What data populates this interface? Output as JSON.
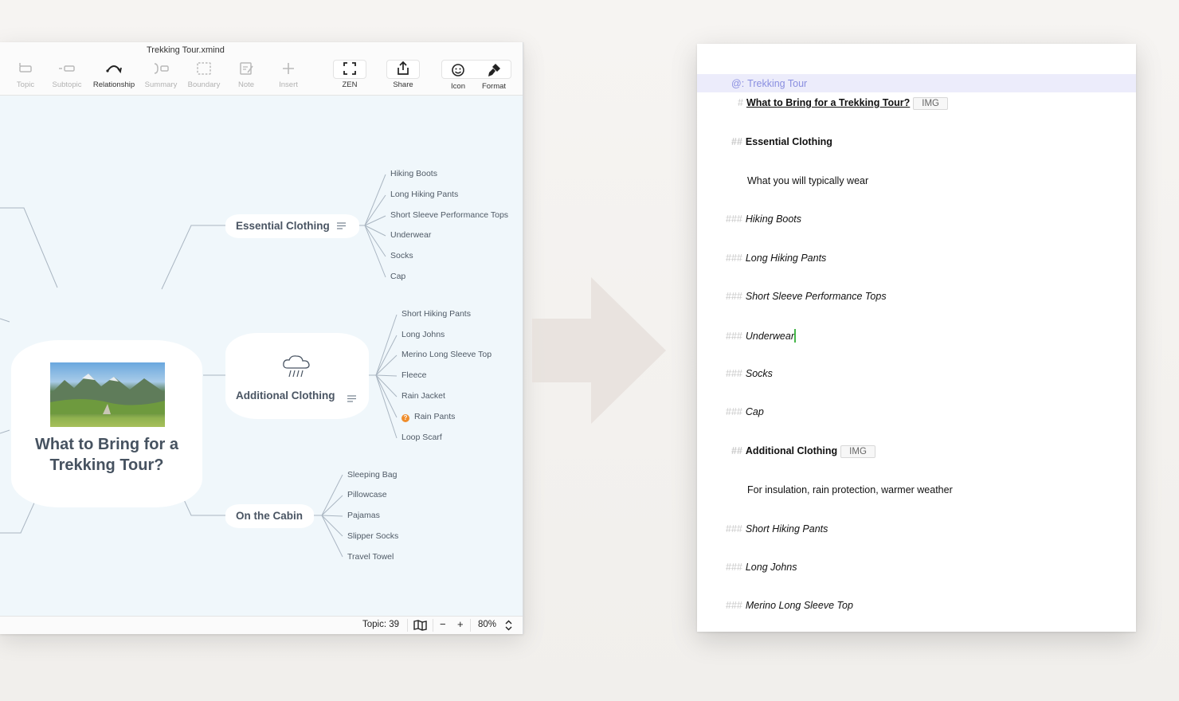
{
  "left_window": {
    "title": "Trekking Tour.xmind",
    "toolbar": [
      {
        "label": "Topic",
        "icon": "topic-icon"
      },
      {
        "label": "Subtopic",
        "icon": "subtopic-icon"
      },
      {
        "label": "Relationship",
        "icon": "relationship-icon"
      },
      {
        "label": "Summary",
        "icon": "summary-icon"
      },
      {
        "label": "Boundary",
        "icon": "boundary-icon"
      },
      {
        "label": "Note",
        "icon": "note-icon"
      },
      {
        "label": "Insert",
        "icon": "insert-icon"
      },
      {
        "label": "ZEN",
        "icon": "zen-icon"
      },
      {
        "label": "Share",
        "icon": "share-icon"
      },
      {
        "label": "Icon",
        "icon": "smiley-icon"
      },
      {
        "label": "Format",
        "icon": "format-brush-icon"
      }
    ],
    "central_topic": {
      "line1": "What to Bring for a",
      "line2": "Trekking Tour?",
      "image": "mountain-landscape-photo"
    },
    "branches": [
      {
        "label": "Essential Clothing",
        "icon": "menu-lines-icon",
        "items": [
          "Hiking Boots",
          "Long Hiking Pants",
          "Short Sleeve Performance Tops",
          "Underwear",
          "Socks",
          "Cap"
        ]
      },
      {
        "label": "Additional Clothing",
        "icon": "menu-lines-icon",
        "image": "rain-cloud-icon",
        "items": [
          "Short Hiking Pants",
          "Long Johns",
          "Merino Long Sleeve Top",
          "Fleece",
          "Rain Jacket",
          "Rain Pants",
          "Loop Scarf"
        ],
        "flagged_item": "Rain Pants",
        "flag_icon": "question-marker-icon"
      },
      {
        "label": "On the Cabin",
        "items": [
          "Sleeping Bag",
          "Pillowcase",
          "Pajamas",
          "Slipper Socks",
          "Travel Towel"
        ]
      }
    ],
    "status": {
      "topic_count": "Topic: 39",
      "map_icon": "outline-map-icon",
      "zoom_out": "−",
      "zoom_in": "+",
      "zoom": "80%"
    }
  },
  "right_window": {
    "lines": [
      {
        "hash": "@:",
        "text": "Trekking Tour",
        "kind": "root"
      },
      {
        "hash": "#",
        "text": "What to Bring for a Trekking Tour?",
        "kind": "h1",
        "tag": "IMG"
      },
      {
        "hash": "##",
        "text": "Essential Clothing",
        "kind": "h2"
      },
      {
        "hash": "",
        "text": "What you will typically wear",
        "kind": "note"
      },
      {
        "hash": "###",
        "text": "Hiking Boots",
        "kind": "h3"
      },
      {
        "hash": "###",
        "text": "Long Hiking Pants",
        "kind": "h3"
      },
      {
        "hash": "###",
        "text": "Short Sleeve Performance Tops",
        "kind": "h3"
      },
      {
        "hash": "###",
        "text": "Underwear",
        "kind": "h3"
      },
      {
        "hash": "###",
        "text": "Socks",
        "kind": "h3"
      },
      {
        "hash": "###",
        "text": "Cap",
        "kind": "h3"
      },
      {
        "hash": "##",
        "text": "Additional Clothing",
        "kind": "h2",
        "tag": "IMG"
      },
      {
        "hash": "",
        "text": "For insulation, rain protection, warmer weather",
        "kind": "note"
      },
      {
        "hash": "###",
        "text": "Short Hiking Pants",
        "kind": "h3"
      },
      {
        "hash": "###",
        "text": "Long Johns",
        "kind": "h3"
      },
      {
        "hash": "###",
        "text": "Merino Long Sleeve Top",
        "kind": "h3"
      }
    ]
  },
  "colors": {
    "canvas_bg": "#f0f7fb",
    "branch_line": "#aab6c2",
    "highlight_row": "#ececfb",
    "cursor": "#45b649",
    "question_marker": "#ef8d2c"
  }
}
